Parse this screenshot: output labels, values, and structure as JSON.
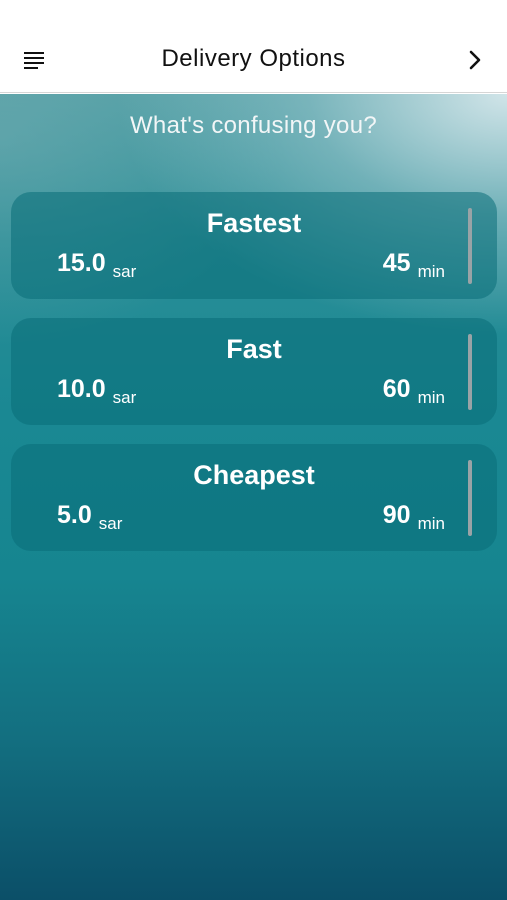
{
  "nav": {
    "title": "Delivery Options",
    "menu_icon": "menu-icon",
    "next_icon": "chevron-right-icon"
  },
  "subtitle": "What's confusing you?",
  "options": [
    {
      "name": "Fastest",
      "price": "15.0",
      "price_unit": "sar",
      "time": "45",
      "time_unit": "min"
    },
    {
      "name": "Fast",
      "price": "10.0",
      "price_unit": "sar",
      "time": "60",
      "time_unit": "min"
    },
    {
      "name": "Cheapest",
      "price": "5.0",
      "price_unit": "sar",
      "time": "90",
      "time_unit": "min"
    }
  ],
  "colors": {
    "background_top": "#4f9ea4",
    "background_bottom": "#0b4f68",
    "card": "#0a6e78"
  }
}
